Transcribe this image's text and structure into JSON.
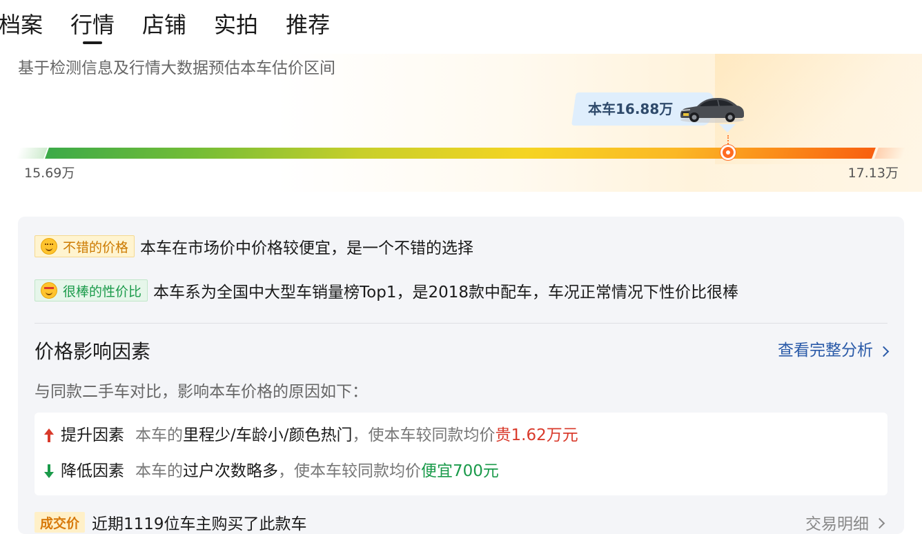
{
  "tabs": [
    {
      "label": "档案"
    },
    {
      "label": "行情",
      "active": true
    },
    {
      "label": "店铺"
    },
    {
      "label": "实拍"
    },
    {
      "label": "推荐"
    }
  ],
  "estimate": {
    "description": "基于检测信息及行情大数据预估本车估价区间",
    "current_price_label": "本车16.88万",
    "range_min": "15.69万",
    "range_max": "17.13万",
    "current_price_wan": 16.88,
    "min_wan": 15.69,
    "max_wan": 17.13
  },
  "badges": [
    {
      "tag": "不错的价格",
      "text": "本车在市场价中价格较便宜，是一个不错的选择"
    },
    {
      "tag": "很棒的性价比",
      "text": "本车系为全国中大型车销量榜Top1，是2018款中配车，车况正常情况下性价比很棒"
    }
  ],
  "factors": {
    "title": "价格影响因素",
    "full_analysis_link": "查看完整分析",
    "subtitle": "与同款二手车对比，影响本车价格的原因如下：",
    "raise": {
      "label": "提升因素",
      "prefix": "本车的",
      "items": "里程少/车龄小/颜色热门",
      "middle": "，使本车较同款均价",
      "value": "贵1.62万元"
    },
    "lower": {
      "label": "降低因素",
      "prefix": "本车的",
      "items": "过户次数略多",
      "middle": "，使本车较同款均价",
      "value": "便宜700元"
    }
  },
  "deal": {
    "tag": "成交价",
    "text": "近期1119位车主购买了此款车",
    "link": "交易明细"
  },
  "colors": {
    "accent_blue": "#2a5aa8",
    "raise_red": "#d93a2b",
    "lower_green": "#1a9a4a",
    "marker_orange": "#ff6c23"
  }
}
